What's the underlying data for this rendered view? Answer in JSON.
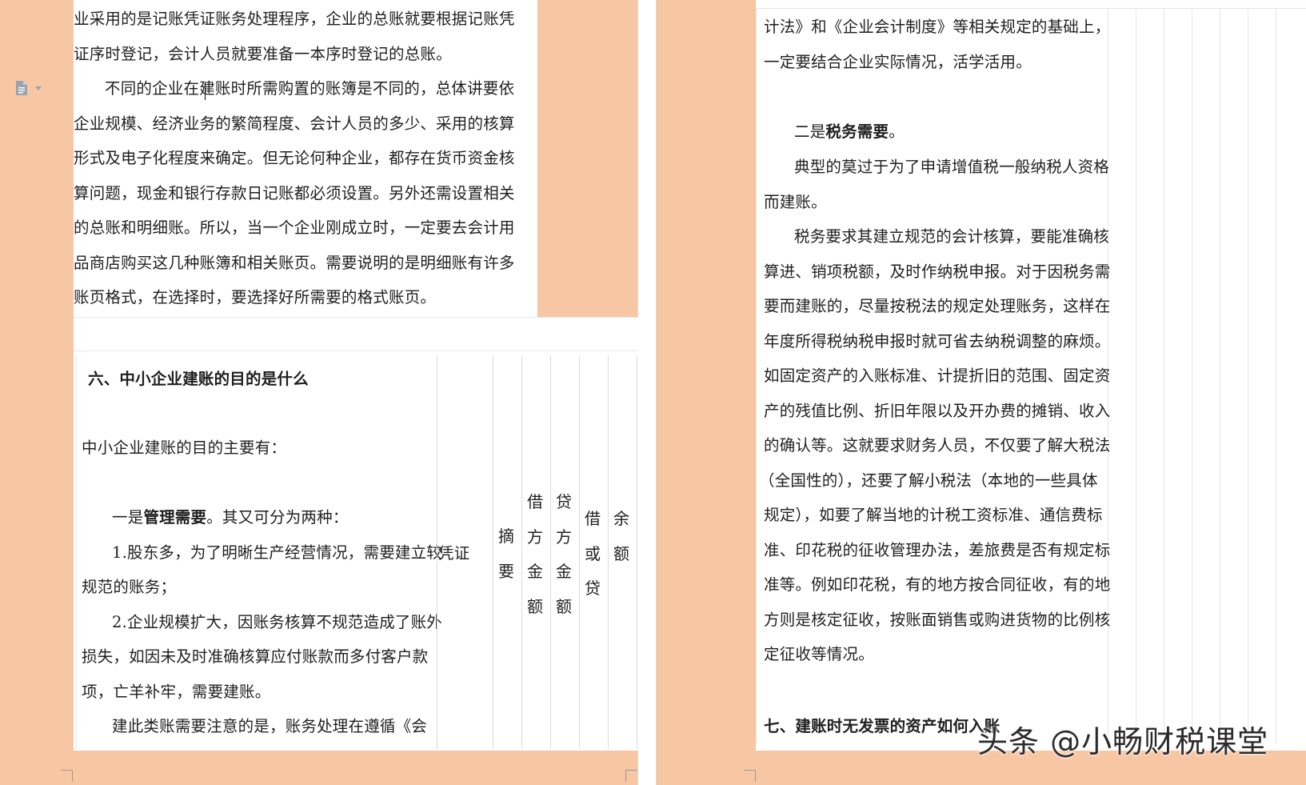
{
  "left_page": {
    "top_paragraph": [
      "业采用的是记账凭证账务处理程序，企业的总账就要根据记账凭",
      "证序时登记，会计人员就要准备一本序时登记的总账。",
      "不同的企业在建账时所需购置的账簿是不同的，总体讲要依",
      "企业规模、经济业务的繁简程度、会计人员的多少、采用的核算",
      "形式及电子化程度来确定。但无论何种企业，都存在货币资金核",
      "算问题，现金和银行存款日记账都必须设置。另外还需设置相关",
      "的总账和明细账。所以，当一个企业刚成立时，一定要去会计用",
      "品商店购买这几种账簿和相关账页。需要说明的是明细账有许多",
      "账页格式，在选择时，要选择好所需要的格式账页。"
    ],
    "section_heading": "六、中小企业建账的目的是什么",
    "intro": "中小企业建账的目的主要有：",
    "point1_prefix": "一是",
    "point1_bold": "管理需要",
    "point1_suffix": "。其又可分为两种：",
    "item1_line1": "1.股东多，为了明晰生产经营情况，需要建立较",
    "item1_line2": "规范的账务；",
    "item2_line1": "2.企业规模扩大，因账务核算不规范造成了账外",
    "item2_line2": "损失，如因未及时准确核算应付账款而多付客户款",
    "item2_line3": "项，亡羊补牢，需要建账。",
    "item3_line1": "建此类账需要注意的是，账务处理在遵循《会",
    "ledger_columns": [
      "凭证",
      "摘要",
      "借方金额",
      "贷方金额",
      "借或贷",
      "余额"
    ]
  },
  "right_page": {
    "lines_a": [
      "计法》和《企业会计制度》等相关规定的基础上，",
      "一定要结合企业实际情况，活学活用。"
    ],
    "point2_prefix": "二是",
    "point2_bold": "税务需要",
    "point2_suffix": "。",
    "lines_b": [
      "典型的莫过于为了申请增值税一般纳税人资格",
      "而建账。",
      "税务要求其建立规范的会计核算，要能准确核",
      "算进、销项税额，及时作纳税申报。对于因税务需",
      "要而建账的，尽量按税法的规定处理账务，这样在",
      "年度所得税纳税申报时就可省去纳税调整的麻烦。",
      "如固定资产的入账标准、计提折旧的范围、固定资",
      "产的残值比例、折旧年限以及开办费的摊销、收入",
      "的确认等。这就要求财务人员，不仅要了解大税法",
      "（全国性的），还要了解小税法（本地的一些具体",
      "规定），如要了解当地的计税工资标准、通信费标",
      "准、印花税的征收管理办法，差旅费是否有规定标",
      "准等。例如印花税，有的地方按合同征收，有的地",
      "方则是核定征收，按账面销售或购进货物的比例核",
      "定征收等情况。"
    ],
    "section_heading": "七、建账时无发票的资产如何入账"
  },
  "watermark": "头条 @小畅财税课堂",
  "icons": {
    "document": "document-icon"
  },
  "colors": {
    "background": "#f7c6a3",
    "paper": "#ffffff",
    "text": "#1f1f1f"
  }
}
